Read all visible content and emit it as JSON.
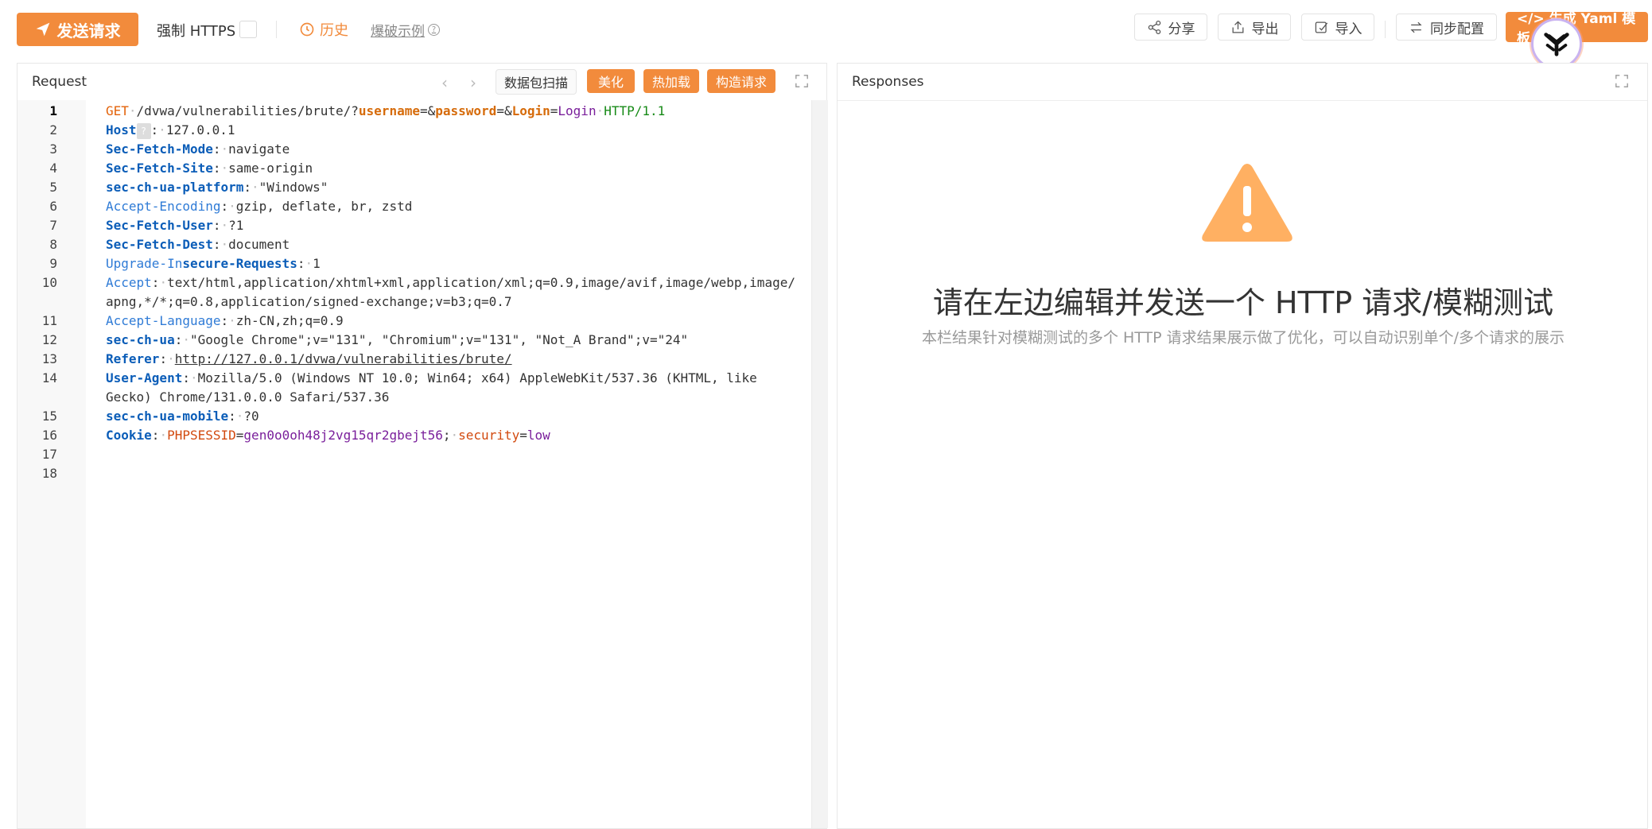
{
  "toolbar": {
    "send_label": "发送请求",
    "https_label": "强制 HTTPS",
    "history_label": "历史",
    "example_label": "爆破示例",
    "share_label": "分享",
    "export_label": "导出",
    "import_label": "导入",
    "sync_label": "同步配置",
    "yaml_label": "</> 生成 Yaml 模板"
  },
  "request": {
    "title": "Request",
    "scan_label": "数据包扫描",
    "beautify_label": "美化",
    "hotload_label": "热加载",
    "build_label": "构造请求",
    "line_numbers": [
      "1",
      "2",
      "3",
      "4",
      "5",
      "6",
      "7",
      "8",
      "9",
      "10",
      "11",
      "12",
      "13",
      "14",
      "15",
      "16",
      "17",
      "18"
    ],
    "lines": [
      {
        "method": "GET",
        "path": "/dvwa/vulnerabilities/brute/?",
        "p1": "username",
        "v1": "",
        "p2": "password",
        "v2": "",
        "p3": "Login",
        "v3": "Login",
        "proto": "HTTP/1.1"
      },
      {
        "name": "Host",
        "value": "127.0.0.1"
      },
      {
        "name": "Sec-Fetch-Mode",
        "value": "navigate"
      },
      {
        "name": "Sec-Fetch-Site",
        "value": "same-origin"
      },
      {
        "name": "sec-ch-ua-platform",
        "value": "\"Windows\""
      },
      {
        "name": "Accept-Encoding",
        "value": "gzip, deflate, br, zstd"
      },
      {
        "name": "Sec-Fetch-User",
        "value": "?1"
      },
      {
        "name": "Sec-Fetch-Dest",
        "value": "document"
      },
      {
        "name_a": "Upgrade-In",
        "name_b": "secure-Requests",
        "value": "1"
      },
      {
        "name": "Accept",
        "value": "text/html,application/xhtml+xml,application/xml;q=0.9,image/avif,image/webp,image/",
        "cont": "apng,*/*;q=0.8,application/signed-exchange;v=b3;q=0.7"
      },
      {
        "name": "Accept-Language",
        "value": "zh-CN,zh;q=0.9"
      },
      {
        "name": "sec-ch-ua",
        "value": "\"Google Chrome\";v=\"131\", \"Chromium\";v=\"131\", \"Not_A Brand\";v=\"24\""
      },
      {
        "name": "Referer",
        "value": "http://127.0.0.1/dvwa/vulnerabilities/brute/"
      },
      {
        "name": "User-Agent",
        "value": "Mozilla/5.0 (Windows NT 10.0; Win64; x64) AppleWebKit/537.36 (KHTML, like",
        "cont": "Gecko) Chrome/131.0.0.0 Safari/537.36"
      },
      {
        "name": "sec-ch-ua-mobile",
        "value": "?0"
      },
      {
        "name": "Cookie",
        "c1": "PHPSESSID",
        "cv1": "gen0o0oh48j2vg15qr2gbejt56",
        "c2": "security",
        "cv2": "low"
      }
    ]
  },
  "response": {
    "title": "Responses",
    "empty_title": "请在左边编辑并发送一个 HTTP 请求/模糊测试",
    "empty_sub": "本栏结果针对模糊测试的多个 HTTP 请求结果展示做了优化，可以自动识别单个/多个请求的展示"
  },
  "colors": {
    "accent": "#f28b3c",
    "warning": "#ffb062"
  }
}
